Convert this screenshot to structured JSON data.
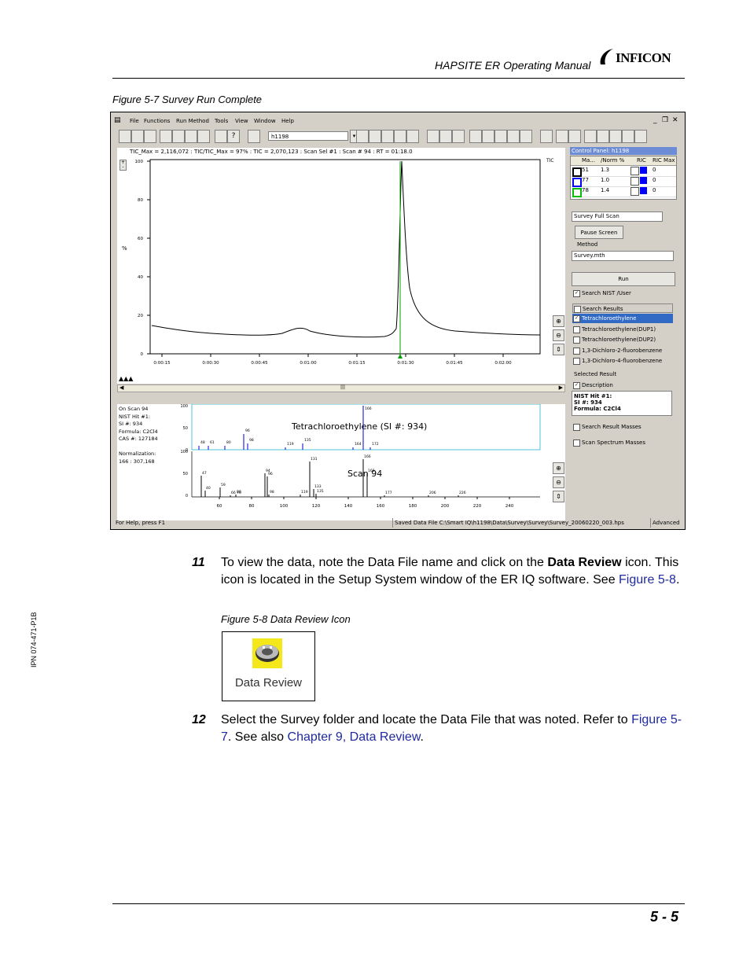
{
  "header": {
    "manual_title": "HAPSITE ER Operating Manual",
    "logo_text": "INFICON"
  },
  "figure_5_7": {
    "caption": "Figure 5-7  Survey Run Complete",
    "menu": [
      "File",
      "Functions",
      "Run Method",
      "Tools",
      "View",
      "Window",
      "Help"
    ],
    "combo_value": "h1198",
    "tic_info": "TIC_Max = 2,116,072 : TIC/TIC_Max = 97% : TIC = 2,070,123 : Scan Sel #1 : Scan # 94 : RT = 01:18.0",
    "y_axis_label": "%",
    "y_ticks": [
      "100",
      "80",
      "60",
      "40",
      "20",
      "0"
    ],
    "x_ticks": [
      "0:00:15",
      "0:00:30",
      "0:00:45",
      "0:01:00",
      "0:01:15",
      "0:01:30",
      "0:01:45",
      "0:02:00"
    ],
    "tic_label": "TIC",
    "control_panel": {
      "title": "Control Panel: h1198",
      "columns": [
        "Ma...",
        "/Norm %",
        "RIC",
        "RIC Max"
      ],
      "rows": [
        {
          "mass": "51",
          "norm": "1.3",
          "ric_max": "0",
          "color": "#000000"
        },
        {
          "mass": "77",
          "norm": "1.0",
          "ric_max": "0",
          "color": "#0000ff"
        },
        {
          "mass": "78",
          "norm": "1.4",
          "ric_max": "0",
          "color": "#00c000"
        }
      ],
      "mode": "Survey Full Scan",
      "pause_button": "Pause Screen",
      "method_label": "Method",
      "method_value": "Survey.mth",
      "run_button": "Run",
      "search_checkbox": "Search NIST /User",
      "search_results_label": "Search Results",
      "results": [
        "Tetrachloroethylene",
        "Tetrachloroethylene(DUP1)",
        "Tetrachloroethylene(DUP2)",
        "1,3-Dichloro-2-fluorobenzene",
        "1,3-Dichloro-4-fluorobenzene"
      ],
      "selected_result_label": "Selected Result",
      "description_label": "Description",
      "description_text": [
        "NIST Hit #1:",
        "SI #: 934",
        "Formula: C2Cl4"
      ],
      "search_masses_label": "Search Result Masses",
      "scan_masses_label": "Scan Spectrum Masses"
    },
    "spectrum_info": [
      "On Scan 94",
      "NIST Hit #1:",
      "SI #: 934",
      "Formula: C2Cl4",
      "CAS #: 127184",
      "",
      "Normalization:",
      "  166 : 307,168"
    ],
    "library_title": "Tetrachloroethylene (SI #: 934)",
    "scan_title": "Scan 94",
    "spectrum_x_ticks": [
      "60",
      "80",
      "100",
      "120",
      "140",
      "160",
      "180",
      "200",
      "220",
      "240"
    ],
    "lib_peak_labels": [
      "48",
      "61",
      "80",
      "96",
      "98",
      "119",
      "135",
      "166",
      "172",
      "164"
    ],
    "scan_peak_labels": [
      "47",
      "40",
      "59",
      "66 70",
      "88",
      "94",
      "96",
      "98",
      "119",
      "131",
      "133",
      "135",
      "166",
      "168",
      "177",
      "206",
      "226"
    ],
    "spec_y_ticks": [
      "100",
      "50",
      "0"
    ],
    "status_left": "For Help, press F1",
    "status_file": "Saved Data File C:\\Smart IQ\\h1198\\Data\\Survey\\Survey\\Survey_20060220_003.hps",
    "status_right": "Advanced"
  },
  "step11": {
    "number": "11",
    "text_a": "To view the data, note the Data File name and click on the ",
    "text_bold": "Data Review",
    "text_b": " icon. This icon is located in the Setup System window of the ER IQ software. See ",
    "link": "Figure 5-8",
    "text_c": "."
  },
  "figure_5_8": {
    "caption": "Figure 5-8  Data Review Icon",
    "icon_label": "Data Review"
  },
  "step12": {
    "number": "12",
    "text_a": "Select the Survey folder and locate the Data File that was noted. Refer to ",
    "link1": "Figure 5-7",
    "text_b": ". See also ",
    "link2": "Chapter 9, Data Review",
    "text_c": "."
  },
  "side_label": "IPN 074-471-P1B",
  "page_number": "5 - 5"
}
